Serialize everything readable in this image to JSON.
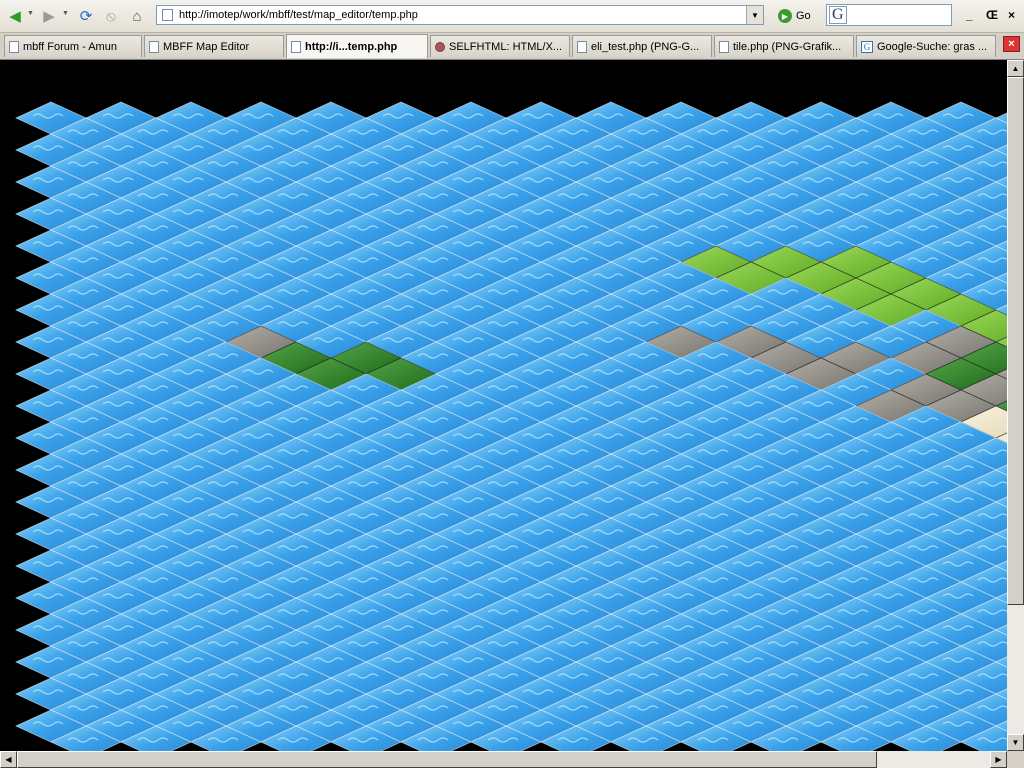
{
  "browser": {
    "url": "http://imotep/work/mbff/test/map_editor/temp.php",
    "go_label": "Go",
    "search_logo": "G",
    "icons": {
      "back": "back-arrow-icon",
      "forward": "forward-arrow-icon",
      "reload": "reload-icon",
      "stop": "stop-icon",
      "home": "home-icon",
      "go": "go-icon",
      "search": "google-search-icon",
      "close_tab": "close-tab-icon"
    },
    "window_buttons": [
      "_",
      "Œ",
      "×"
    ]
  },
  "tabs": [
    {
      "label": "mbff Forum - Amun",
      "icon": "page"
    },
    {
      "label": "MBFF Map Editor",
      "icon": "page"
    },
    {
      "label": "http://i...temp.php",
      "icon": "page",
      "active": true
    },
    {
      "label": "SELFHTML: HTML/X...",
      "icon": "ball"
    },
    {
      "label": "eli_test.php (PNG-G...",
      "icon": "page"
    },
    {
      "label": "tile.php (PNG-Grafik...",
      "icon": "page"
    },
    {
      "label": "Google-Suche: gras ...",
      "icon": "google"
    }
  ],
  "map": {
    "name": "isometric-tile-map",
    "background_tile": "water",
    "colors": {
      "water": "#3aa2ea",
      "water_hi": "#8dd3fa",
      "grass": "#6fbd2e",
      "grass_hi": "#9cd95a",
      "forest": "#2c7a24",
      "forest_hi": "#55a64a",
      "rock": "#8d8d88",
      "rock_hi": "#b3b0a8",
      "sand": "#efe4c6",
      "sand_hi": "#faf4e2",
      "dirt": "#8a3a14",
      "dirt_hi": "#a9562a",
      "void": "#000000"
    },
    "terrain_tiles": {
      "grass": [
        [
          9,
          9
        ],
        [
          10,
          10
        ],
        [
          11,
          11
        ],
        [
          11,
          10
        ],
        [
          12,
          11
        ],
        [
          12,
          12
        ],
        [
          13,
          13
        ],
        [
          13,
          12
        ],
        [
          14,
          13
        ],
        [
          14,
          14
        ],
        [
          10,
          9
        ],
        [
          11,
          9
        ],
        [
          12,
          10
        ],
        [
          17,
          18
        ],
        [
          18,
          19
        ],
        [
          18,
          18
        ],
        [
          19,
          19
        ],
        [
          19,
          20
        ],
        [
          20,
          21
        ],
        [
          21,
          22
        ],
        [
          21,
          21
        ],
        [
          22,
          22
        ],
        [
          22,
          23
        ],
        [
          23,
          24
        ],
        [
          21,
          20
        ],
        [
          20,
          20
        ],
        [
          19,
          18
        ],
        [
          17,
          17
        ],
        [
          16,
          17
        ],
        [
          15,
          16
        ]
      ],
      "rock": [
        [
          3,
          14
        ],
        [
          9,
          14
        ],
        [
          10,
          14
        ],
        [
          10,
          15
        ],
        [
          11,
          15
        ],
        [
          11,
          16
        ],
        [
          12,
          17
        ],
        [
          13,
          17
        ],
        [
          12,
          18
        ],
        [
          13,
          18
        ],
        [
          13,
          14
        ],
        [
          12,
          15
        ],
        [
          14,
          16
        ],
        [
          15,
          17
        ],
        [
          14,
          15
        ],
        [
          15,
          18
        ],
        [
          16,
          19
        ],
        [
          19,
          21
        ],
        [
          20,
          22
        ],
        [
          18,
          21
        ]
      ],
      "forest": [
        [
          3,
          15
        ],
        [
          4,
          15
        ],
        [
          4,
          16
        ],
        [
          5,
          16
        ],
        [
          13,
          15
        ],
        [
          13,
          16
        ],
        [
          14,
          17
        ],
        [
          15,
          19
        ],
        [
          14,
          18
        ],
        [
          15,
          20
        ],
        [
          16,
          21
        ],
        [
          16,
          20
        ],
        [
          17,
          20
        ],
        [
          17,
          21
        ],
        [
          18,
          22
        ],
        [
          16,
          18
        ],
        [
          17,
          19
        ]
      ],
      "sand": [
        [
          13,
          19
        ],
        [
          14,
          20
        ],
        [
          14,
          21
        ],
        [
          15,
          21
        ],
        [
          15,
          22
        ],
        [
          16,
          23
        ],
        [
          16,
          24
        ],
        [
          17,
          24
        ],
        [
          17,
          25
        ],
        [
          18,
          25
        ],
        [
          18,
          26
        ],
        [
          19,
          26
        ],
        [
          16,
          22
        ],
        [
          17,
          22
        ],
        [
          18,
          23
        ],
        [
          19,
          24
        ],
        [
          19,
          25
        ],
        [
          20,
          25
        ],
        [
          20,
          26
        ],
        [
          17,
          23
        ],
        [
          18,
          24
        ]
      ],
      "dirt": [
        [
          20,
          27
        ],
        [
          21,
          27
        ],
        [
          21,
          28
        ],
        [
          22,
          28
        ],
        [
          22,
          29
        ],
        [
          23,
          29
        ],
        [
          23,
          30
        ],
        [
          24,
          30
        ],
        [
          24,
          31
        ],
        [
          20,
          28
        ],
        [
          21,
          29
        ],
        [
          22,
          30
        ],
        [
          23,
          31
        ],
        [
          24,
          32
        ],
        [
          19,
          27
        ],
        [
          20,
          29
        ],
        [
          21,
          30
        ],
        [
          22,
          31
        ],
        [
          23,
          32
        ],
        [
          19,
          28
        ],
        [
          20,
          30
        ],
        [
          21,
          31
        ],
        [
          22,
          32
        ],
        [
          23,
          33
        ]
      ]
    }
  }
}
